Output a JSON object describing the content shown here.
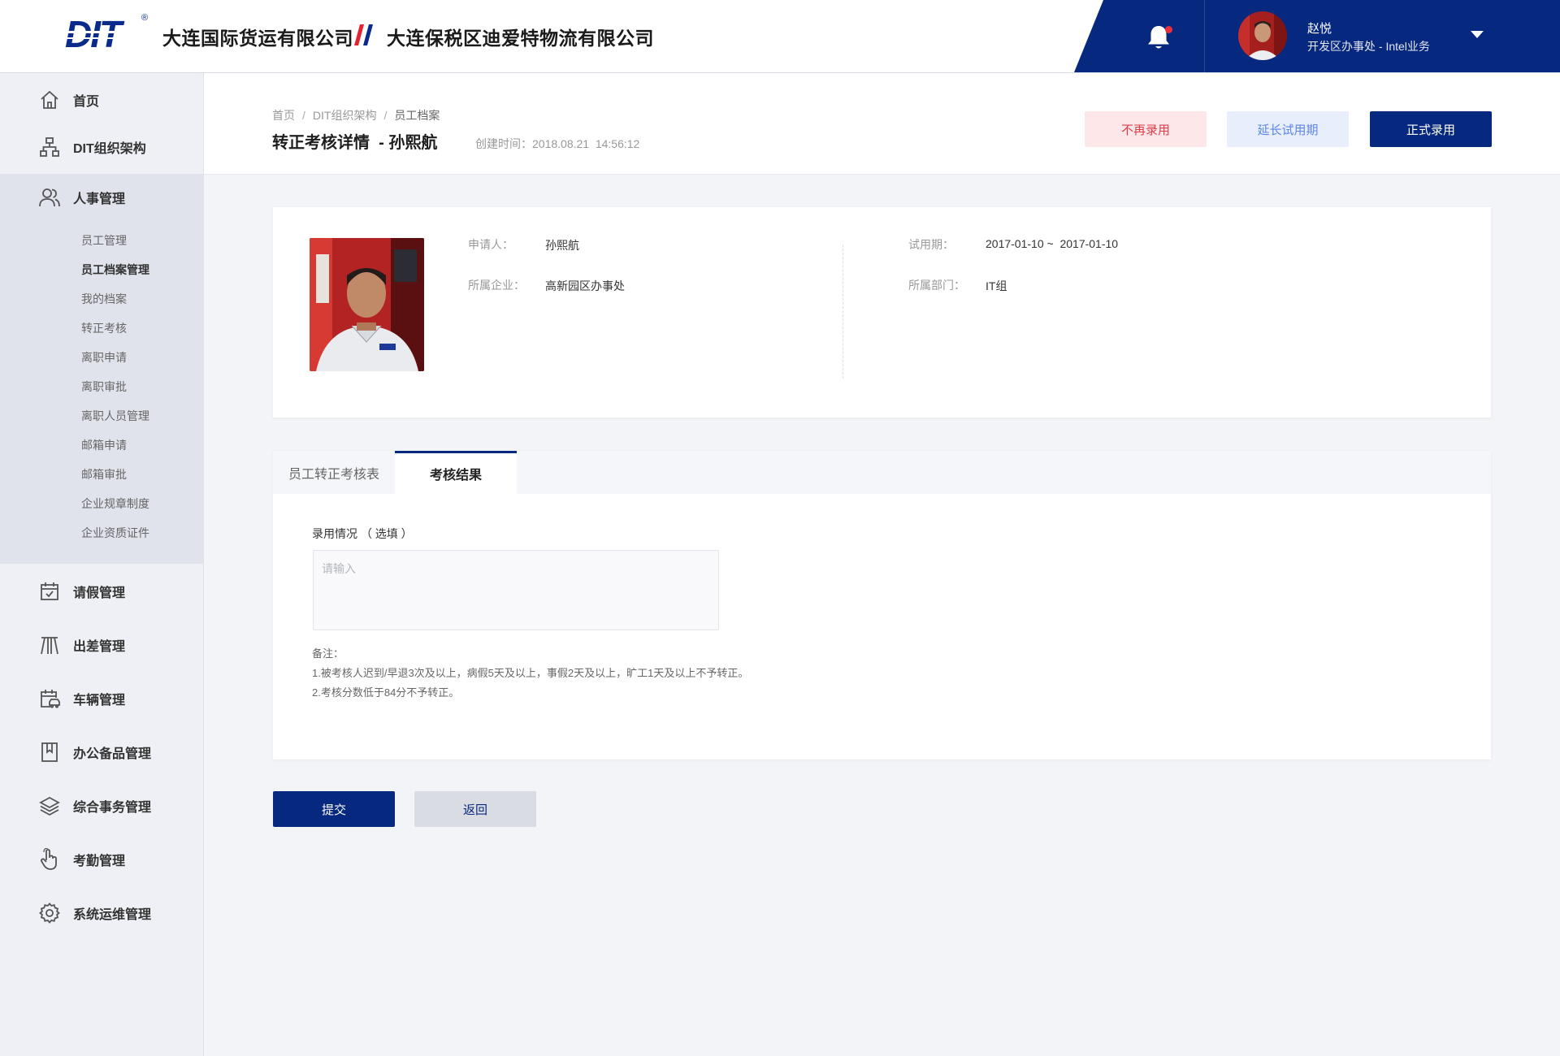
{
  "header": {
    "logo_text": "DIT",
    "logo_reg": "®",
    "company_a": "大连国际货运有限公司",
    "company_b": "大连保税区迪爱特物流有限公司",
    "user_name": "赵悦",
    "user_dept": "开发区办事处 - Intel业务",
    "notification_dot_color": "#e8313d",
    "brand_color": "#07287f"
  },
  "sidebar": {
    "items": [
      {
        "label": "首页",
        "icon": "home-icon"
      },
      {
        "label": "DIT组织架构",
        "icon": "org-chart-icon"
      },
      {
        "label": "人事管理",
        "icon": "users-icon"
      },
      {
        "label": "请假管理",
        "icon": "calendar-icon"
      },
      {
        "label": "出差管理",
        "icon": "road-icon"
      },
      {
        "label": "车辆管理",
        "icon": "car-schedule-icon"
      },
      {
        "label": "办公备品管理",
        "icon": "bookmark-icon"
      },
      {
        "label": "综合事务管理",
        "icon": "layers-icon"
      },
      {
        "label": "考勤管理",
        "icon": "hand-tap-icon"
      },
      {
        "label": "系统运维管理",
        "icon": "gear-icon"
      }
    ],
    "hr_subitems": [
      "员工管理",
      "员工档案管理",
      "我的档案",
      "转正考核",
      "离职申请",
      "离职审批",
      "离职人员管理",
      "邮箱申请",
      "邮箱审批",
      "企业规章制度",
      "企业资质证件"
    ],
    "active_subitem": "员工档案管理"
  },
  "page": {
    "breadcrumb": [
      "首页",
      "DIT组织架构",
      "员工档案"
    ],
    "breadcrumb_sep": "/",
    "title": "转正考核详情  - 孙熙航",
    "created": "创建时间：2018.08.21  14:56:12",
    "actions": {
      "reject": "不再录用",
      "extend": "延长试用期",
      "hire": "正式录用"
    }
  },
  "applicant": {
    "applicant_label": "申请人：",
    "applicant_value": "孙熙航",
    "company_label": "所属企业：",
    "company_value": "高新园区办事处",
    "probation_label": "试用期：",
    "probation_value": "2017-01-10 ~  2017-01-10",
    "dept_label": "所属部门：",
    "dept_value": "IT组"
  },
  "tabs": {
    "items": [
      "员工转正考核表",
      "考核结果"
    ],
    "active": "考核结果"
  },
  "result_form": {
    "label": "录用情况 （ 选填 ）",
    "placeholder": "请输入",
    "value": "",
    "notes": [
      "备注：",
      "1.被考核人迟到/早退3次及以上，病假5天及以上，事假2天及以上，旷工1天及以上不予转正。",
      "2.考核分数低于84分不予转正。"
    ]
  },
  "footer_buttons": {
    "submit": "提交",
    "back": "返回"
  }
}
